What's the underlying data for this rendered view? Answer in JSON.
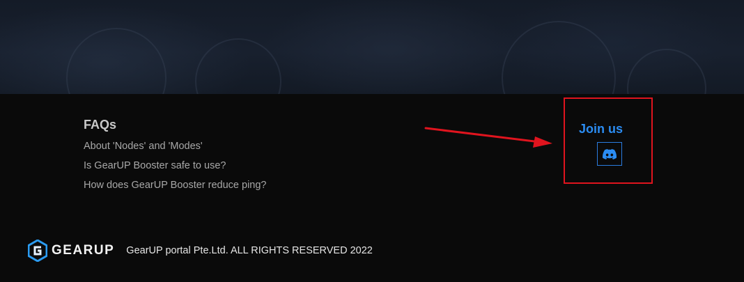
{
  "faq": {
    "title": "FAQs",
    "links": [
      "About 'Nodes' and 'Modes'",
      "Is GearUP Booster safe to use?",
      "How does GearUP Booster reduce ping?"
    ]
  },
  "join": {
    "title": "Join us",
    "discord_icon": "discord-icon"
  },
  "footer": {
    "logo_text": "GEARUP",
    "copyright": "GearUP portal Pte.Ltd. ALL RIGHTS RESERVED 2022"
  },
  "colors": {
    "accent": "#2b8cf2",
    "highlight": "#e0141e",
    "background": "#0a0a0a"
  }
}
